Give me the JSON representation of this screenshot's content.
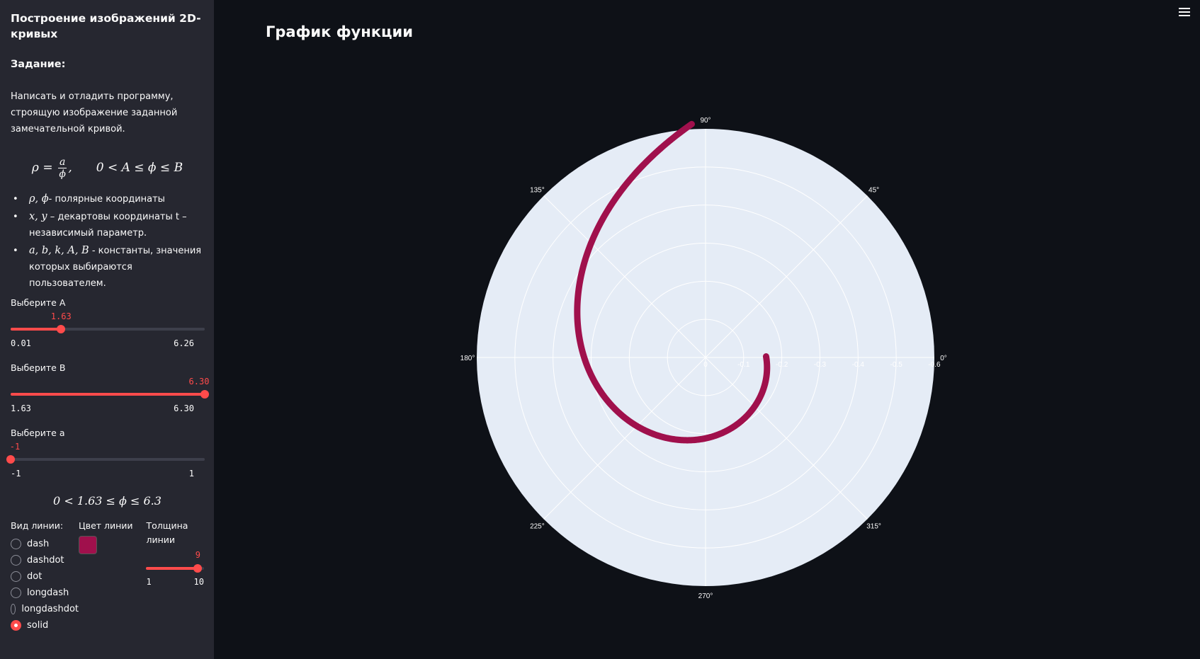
{
  "sidebar": {
    "title": "Построение изображений 2D-кривых",
    "task_heading": "Задание:",
    "task_text": "Написать и отладить программу, строящую изображение заданной замечательной кривой.",
    "formula_left_rho": "ρ = ",
    "formula_frac_num": "a",
    "formula_frac_den": "ϕ",
    "formula_comma": ",",
    "formula_right": "0 < A ≤ ϕ ≤ B",
    "bullets": [
      {
        "math": "ρ, ϕ",
        "text": "- полярные координаты"
      },
      {
        "math": "x, y",
        "text": " – декартовы координаты t – независимый параметр."
      },
      {
        "math": "a, b, k, A, B",
        "text": " - константы, значения которых выбираются пользователем."
      }
    ],
    "slider_A": {
      "label": "Выберите A",
      "value": "1.63",
      "min": "0.01",
      "max": "6.26",
      "fraction": 0.26
    },
    "slider_B": {
      "label": "Выберите B",
      "value": "6.30",
      "min": "1.63",
      "max": "6.30",
      "fraction": 1.0
    },
    "slider_a": {
      "label": "Выберите a",
      "value": "-1",
      "min": "-1",
      "max": "1",
      "fraction": 0.0
    },
    "range_formula": "0 < 1.63 ≤ ϕ ≤ 6.3",
    "line_type_label": "Вид линии:",
    "line_types": [
      "dash",
      "dashdot",
      "dot",
      "longdash",
      "longdashdot",
      "solid"
    ],
    "line_type_selected": "solid",
    "line_color_label": "Цвет линии",
    "line_color": "#a0104c",
    "width_label": "Толщина линии",
    "width_slider": {
      "value": "9",
      "min": "1",
      "max": "10",
      "fraction": 0.889
    }
  },
  "main": {
    "title": "График функции"
  },
  "chart_data": {
    "type": "line",
    "coordinate_system": "polar",
    "function": "rho = a / phi",
    "a": -1,
    "phi_range": [
      1.63,
      6.3
    ],
    "radial_range": [
      -0.6,
      0
    ],
    "radial_ticks": [
      "0",
      "-0.1",
      "-0.2",
      "-0.3",
      "-0.4",
      "-0.5",
      "-0.6"
    ],
    "angular_ticks": [
      "0°",
      "45°",
      "90°",
      "135°",
      "180°",
      "225°",
      "270°",
      "315°"
    ],
    "line_color": "#a0104c",
    "line_width": 9,
    "line_dash": "solid",
    "background": "#e5ecf6",
    "grid": true
  }
}
